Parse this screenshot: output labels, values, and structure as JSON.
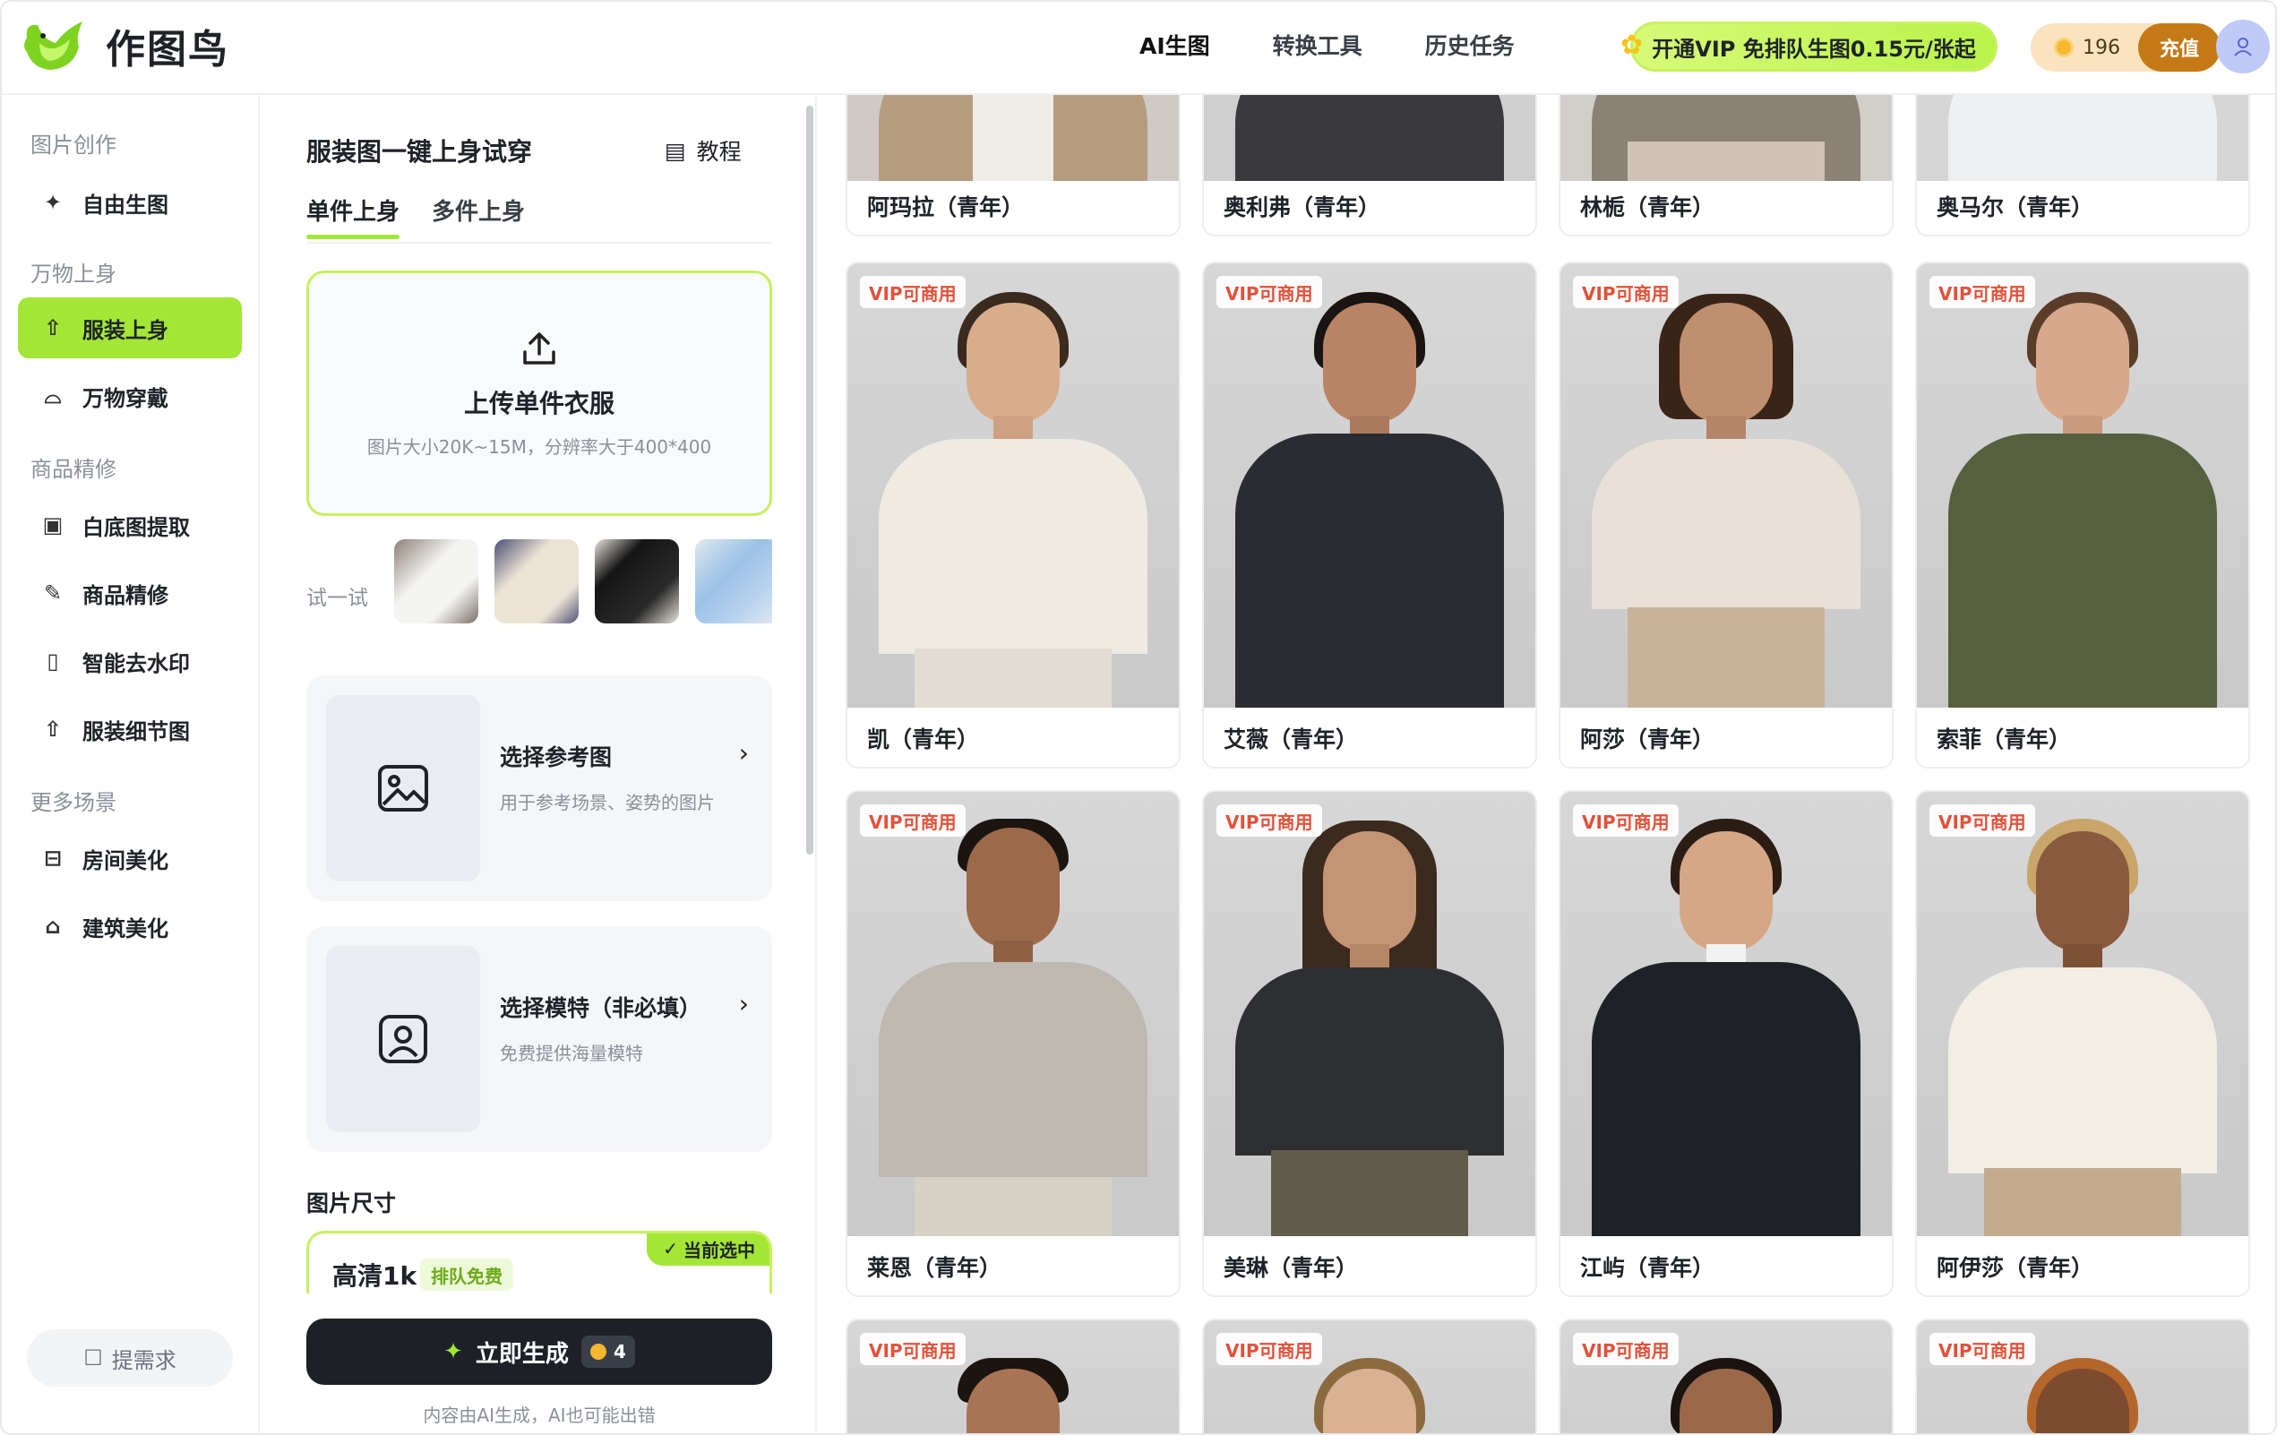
{
  "header": {
    "logo_text": "作图鸟",
    "nav": [
      "AI生图",
      "转换工具",
      "历史任务"
    ],
    "vip_banner": "开通VIP 免排队生图0.15元/张起",
    "coin_count": "196",
    "recharge_label": "充值"
  },
  "sidebar": {
    "sections": [
      {
        "title": "图片创作",
        "items": [
          {
            "label": "自由生图",
            "icon": "sparkle-icon"
          }
        ]
      },
      {
        "title": "万物上身",
        "items": [
          {
            "label": "服装上身",
            "icon": "shirt-icon"
          },
          {
            "label": "万物穿戴",
            "icon": "shoe-icon"
          }
        ]
      },
      {
        "title": "商品精修",
        "items": [
          {
            "label": "白底图提取",
            "icon": "image-icon"
          },
          {
            "label": "商品精修",
            "icon": "pen-icon"
          },
          {
            "label": "智能去水印",
            "icon": "eraser-icon"
          },
          {
            "label": "服装细节图",
            "icon": "shirt-detail-icon"
          }
        ]
      },
      {
        "title": "更多场景",
        "items": [
          {
            "label": "房间美化",
            "icon": "sofa-icon"
          },
          {
            "label": "建筑美化",
            "icon": "building-icon"
          }
        ]
      }
    ],
    "active_item": "服装上身",
    "feedback_label": "提需求"
  },
  "panel": {
    "title": "服装图一键上身试穿",
    "tutorial_label": "教程",
    "tabs": [
      "单件上身",
      "多件上身"
    ],
    "upload": {
      "title": "上传单件衣服",
      "subtitle": "图片大小20K~15M，分辨率大于400*400"
    },
    "try_label": "试一试",
    "reference": {
      "title": "选择参考图",
      "subtitle": "用于参考场景、姿势的图片"
    },
    "model": {
      "title": "选择模特（非必填）",
      "subtitle": "免费提供海量模特"
    },
    "size_label": "图片尺寸",
    "size_option": {
      "name": "高清1k",
      "tag": "排队免费",
      "selected_badge": "当前选中"
    },
    "generate": {
      "label": "立即生成",
      "cost": "4"
    },
    "disclaimer": "内容由AI生成，AI也可能出错"
  },
  "gallery": {
    "vip_tag": "VIP可商用",
    "rows": [
      [
        "阿玛拉（青年）",
        "奥利弗（青年）",
        "林栀（青年）",
        "奥马尔（青年）"
      ],
      [
        "凯（青年）",
        "艾薇（青年）",
        "阿莎（青年）",
        "索菲（青年）"
      ],
      [
        "莱恩（青年）",
        "美琳（青年）",
        "江屿（青年）",
        "阿伊莎（青年）"
      ]
    ]
  },
  "colors": {
    "accent": "#a3e635",
    "vip_red": "#e2513a",
    "recharge": "#c67a17"
  }
}
